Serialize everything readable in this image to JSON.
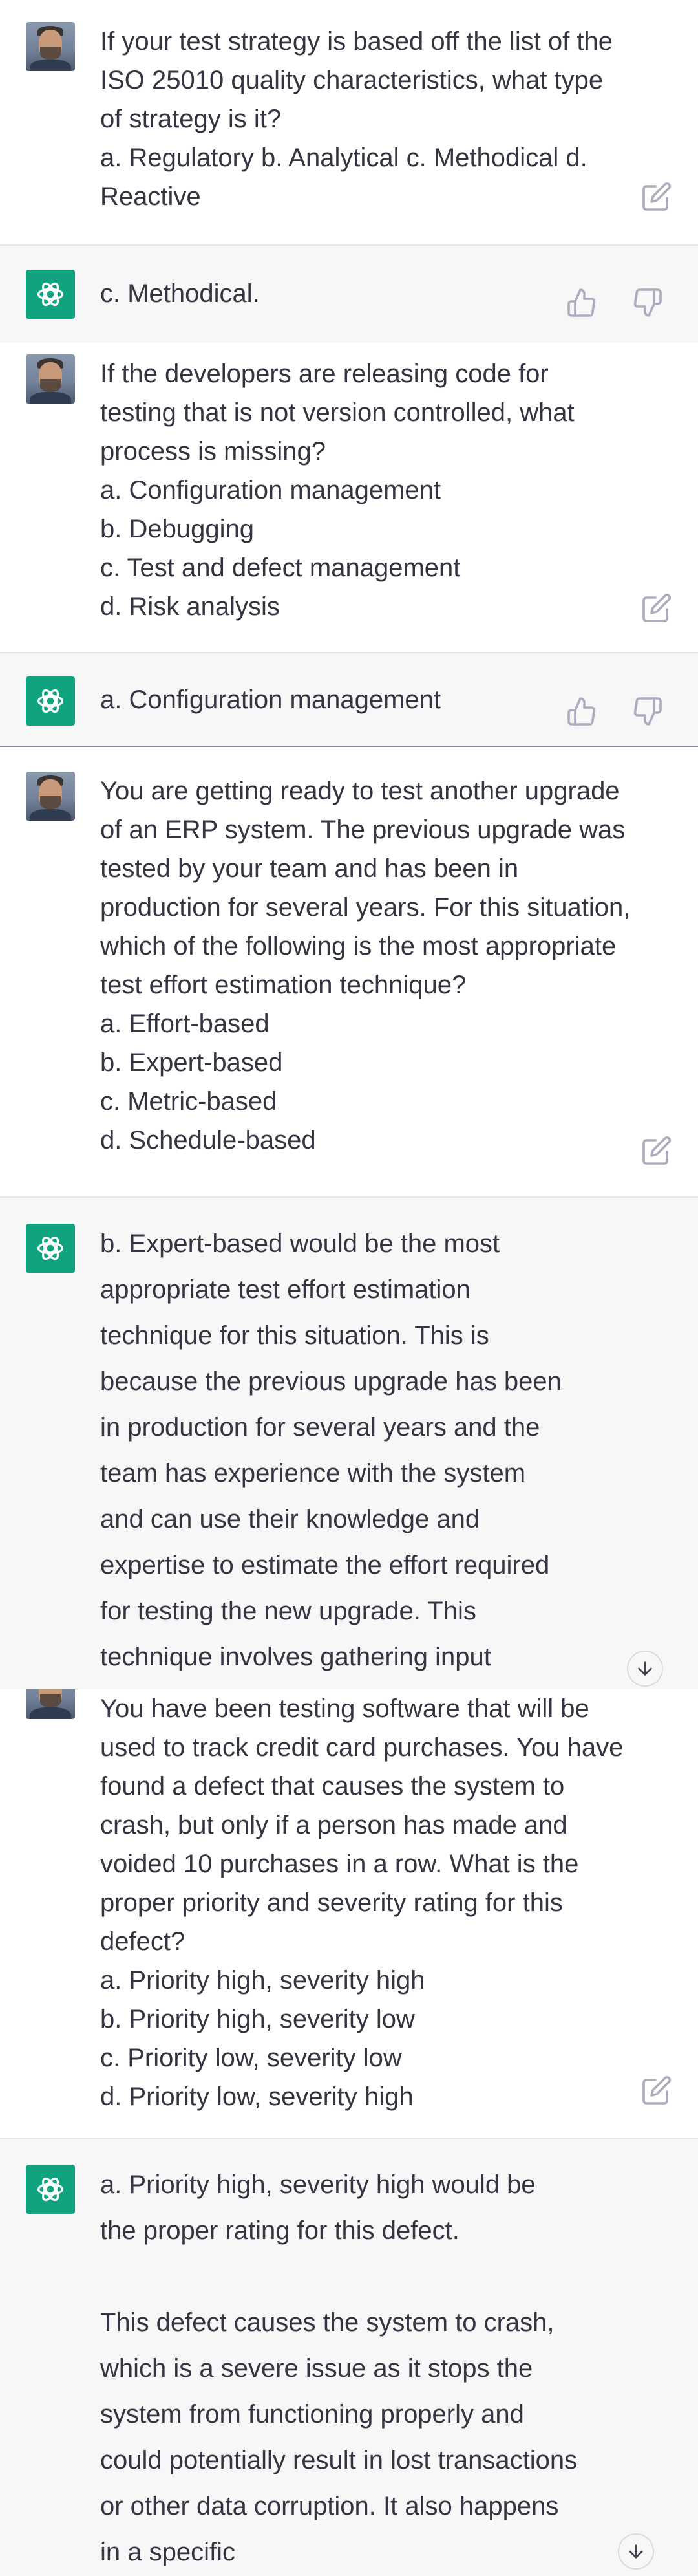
{
  "messages": [
    {
      "role": "user",
      "text": "If your test strategy is based off the list of the ISO 25010 quality characteristics, what type of strategy is it?\na. Regulatory b. Analytical c. Methodical d. Reactive"
    },
    {
      "role": "assistant",
      "text": "c. Methodical."
    },
    {
      "role": "user",
      "text": "If the developers are releasing code for testing that is not version controlled, what process is missing?\na. Configuration management\nb. Debugging\nc. Test and defect management\nd. Risk analysis"
    },
    {
      "role": "assistant",
      "text": "a. Configuration management"
    },
    {
      "role": "user",
      "text": "You are getting ready to test another upgrade of an ERP system. The previous upgrade was tested by your team and has been in production for several years. For this situation, which of the following is the most appropriate test effort estimation technique?\na. Effort-based\nb. Expert-based\nc. Metric-based\nd. Schedule-based"
    },
    {
      "role": "assistant",
      "text": "b. Expert-based would be the most appropriate test effort estimation technique for this situation. This is because the previous upgrade has been in production for several years and the team has experience with the system and can use their knowledge and expertise to estimate the effort required for testing the new upgrade. This technique involves gathering input"
    },
    {
      "role": "user",
      "text": "You have been testing software that will be used to track credit card purchases. You have found a defect that causes the system to crash, but only if a person has made and voided 10 purchases in a row. What is the proper priority and severity rating for this defect?\na. Priority high, severity high\nb. Priority high, severity low\nc. Priority low, severity low\nd. Priority low, severity high"
    },
    {
      "role": "assistant",
      "text": "a. Priority high, severity high would be the proper rating for this defect.\n\nThis defect causes the system to crash, which is a severe issue as it stops the system from functioning properly and could potentially result in lost transactions or other data corruption. It also happens in a specific"
    }
  ],
  "colors": {
    "assistant_bg": "#f7f7f8",
    "user_bg": "#ffffff",
    "openai_green": "#10a37f",
    "text": "#343541",
    "icon": "#acacbe"
  },
  "icons": {
    "edit": "edit-icon",
    "thumbs_up": "thumbs-up-icon",
    "thumbs_down": "thumbs-down-icon",
    "scroll": "arrow-down-icon",
    "logo": "openai-logo-icon"
  }
}
